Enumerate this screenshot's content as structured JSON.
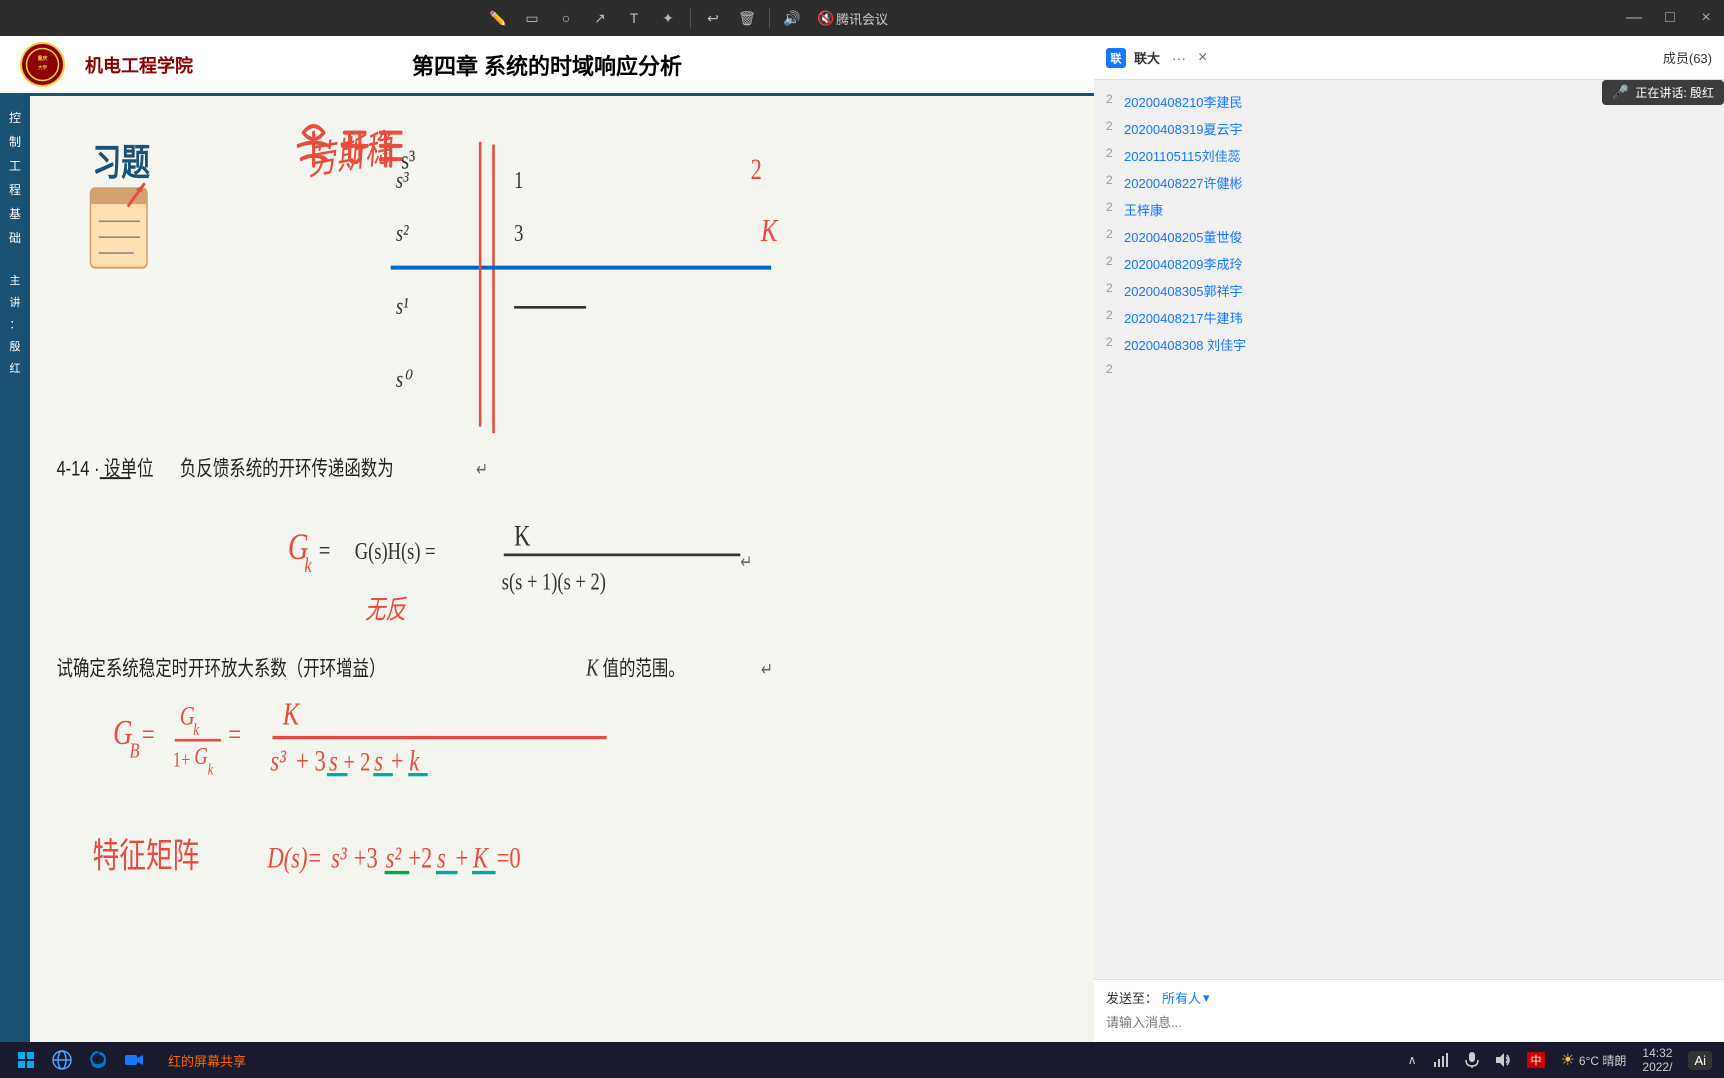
{
  "titlebar": {
    "title": "腾讯会议",
    "close_label": "×",
    "minimize_label": "—",
    "maximize_label": "□"
  },
  "tools": {
    "pen_icon": "✏",
    "rect_icon": "▭",
    "circle_icon": "○",
    "arrow_icon": "↗",
    "text_icon": "T",
    "laser_icon": "⊕",
    "undo_icon": "↩",
    "trash_icon": "🗑",
    "volume_icon": "🔊",
    "mute_icon": "🔇",
    "close_icon": "×"
  },
  "slide": {
    "school_name": "机电工程学院",
    "chapter_title": "第四章  系统的时域响应分析",
    "section_title": "习题",
    "side_chars": [
      "控",
      "制",
      "工",
      "程",
      "基",
      "础"
    ],
    "side_subtitle_chars": [
      "主",
      "讲",
      "：",
      "殷",
      "红"
    ],
    "problem_label": "4-14·设单位负反馈系统的开环传递函数为",
    "problem_note": "试确定系统稳定时开环放大系数（开环增益）K值的范围。"
  },
  "right_panel": {
    "tab_icon": "联",
    "tab_label": "联大",
    "more_label": "···",
    "close_label": "×",
    "member_count": "成员(63)",
    "speaking_text": "正在讲话: 殷红",
    "chat_items": [
      {
        "count": "2",
        "name": "20200408210李建民"
      },
      {
        "count": "2",
        "name": "20200408319夏云宇"
      },
      {
        "count": "2",
        "name": "20201105115刘佳蕊"
      },
      {
        "count": "2",
        "name": "20200408227许健彬"
      },
      {
        "count": "2",
        "name": "王梓康"
      },
      {
        "count": "2",
        "name": "20200408205董世俊"
      },
      {
        "count": "2",
        "name": "20200408209李成玲"
      },
      {
        "count": "2",
        "name": "20200408305郭祥宇"
      },
      {
        "count": "2",
        "name": "20200408217牛建玮"
      },
      {
        "count": "2",
        "name": "20200408308 刘佳宇"
      },
      {
        "count": "2",
        "name": ""
      }
    ],
    "send_to_label": "发送至：",
    "send_to_value": "所有人",
    "input_placeholder": "请输入消息..."
  },
  "bottom_bar": {
    "screen_share_label": "红的屏幕共享",
    "weather_icon": "☀",
    "temperature": "6°C  晴朗",
    "datetime": "14:32\n2022/",
    "taskbar_icons": [
      "⊞",
      "🌐",
      "e",
      "M"
    ]
  },
  "ai_label": "Ai"
}
